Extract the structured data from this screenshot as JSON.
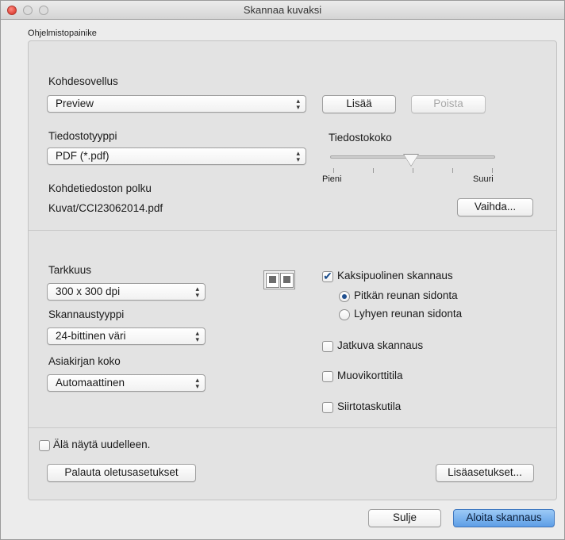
{
  "window": {
    "title": "Skannaa kuvaksi"
  },
  "group": {
    "label": "Ohjelmistopainike"
  },
  "target_app": {
    "label": "Kohdesovellus",
    "value": "Preview",
    "add_button": "Lisää",
    "remove_button": "Poista"
  },
  "file_type": {
    "label": "Tiedostotyyppi",
    "value": "PDF (*.pdf)"
  },
  "file_size": {
    "label": "Tiedostokoko",
    "min_label": "Pieni",
    "max_label": "Suuri",
    "level": 0.5
  },
  "dest_path": {
    "label": "Kohdetiedoston polku",
    "value": "Kuvat/CCI23062014.pdf",
    "change_button": "Vaihda..."
  },
  "resolution": {
    "label": "Tarkkuus",
    "value": "300 x 300 dpi"
  },
  "scan_type": {
    "label": "Skannaustyyppi",
    "value": "24-bittinen väri"
  },
  "doc_size": {
    "label": "Asiakirjan koko",
    "value": "Automaattinen"
  },
  "options": {
    "duplex": {
      "label": "Kaksipuolinen skannaus",
      "checked": true
    },
    "long_edge": {
      "label": "Pitkän reunan sidonta",
      "selected": true
    },
    "short_edge": {
      "label": "Lyhyen reunan sidonta",
      "selected": false
    },
    "continuous": {
      "label": "Jatkuva skannaus",
      "checked": false
    },
    "plastic_card": {
      "label": "Muovikorttitila",
      "checked": false
    },
    "carrier_sheet": {
      "label": "Siirtotaskutila",
      "checked": false
    }
  },
  "dont_show": {
    "label": "Älä näytä uudelleen.",
    "checked": false
  },
  "restore_button": "Palauta oletusasetukset",
  "advanced_button": "Lisäasetukset...",
  "close_button": "Sulje",
  "start_button": "Aloita skannaus"
}
